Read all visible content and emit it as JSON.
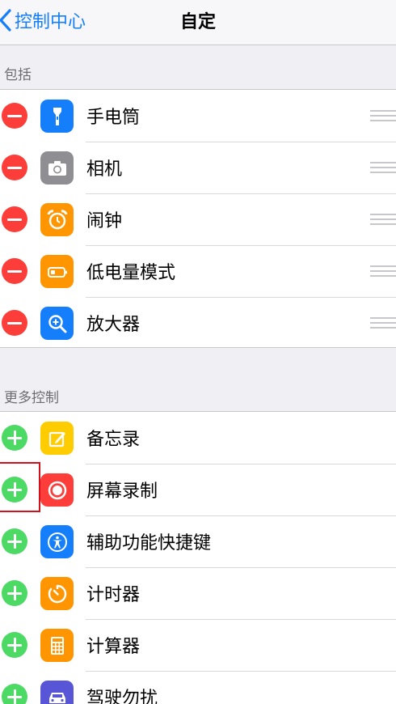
{
  "navbar": {
    "back_label": "控制中心",
    "title": "自定"
  },
  "included": {
    "header": "包括",
    "items": [
      {
        "label": "手电筒",
        "icon": "flashlight-icon",
        "color": "#157efb"
      },
      {
        "label": "相机",
        "icon": "camera-icon",
        "color": "#8e8e93"
      },
      {
        "label": "闹钟",
        "icon": "alarm-clock-icon",
        "color": "#ff9500"
      },
      {
        "label": "低电量模式",
        "icon": "battery-icon",
        "color": "#ff9500"
      },
      {
        "label": "放大器",
        "icon": "magnifier-icon",
        "color": "#157efb"
      }
    ]
  },
  "more": {
    "header": "更多控制",
    "items": [
      {
        "label": "备忘录",
        "icon": "notes-icon",
        "color": "#ffcc00"
      },
      {
        "label": "屏幕录制",
        "icon": "screen-record-icon",
        "color": "#fc3d39"
      },
      {
        "label": "辅助功能快捷键",
        "icon": "accessibility-icon",
        "color": "#157efb"
      },
      {
        "label": "计时器",
        "icon": "timer-icon",
        "color": "#ff9500"
      },
      {
        "label": "计算器",
        "icon": "calculator-icon",
        "color": "#ff9500"
      },
      {
        "label": "驾驶勿扰",
        "icon": "car-icon",
        "color": "#5856d6"
      }
    ]
  },
  "colors": {
    "accent": "#157efb",
    "remove": "#fc3d39",
    "add": "#4cd964",
    "highlight": "#d0111b"
  }
}
